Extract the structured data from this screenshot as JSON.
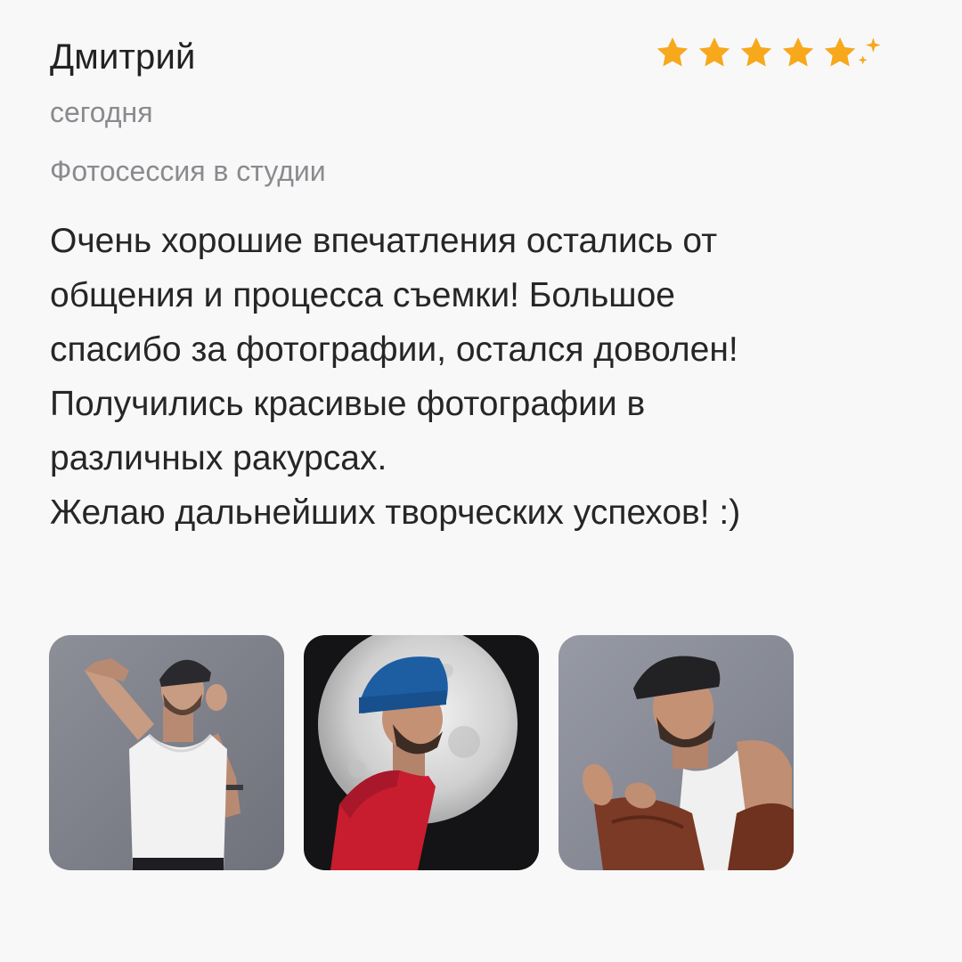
{
  "review": {
    "author": "Дмитрий",
    "date": "сегодня",
    "service": "Фотосессия в студии",
    "rating": 5,
    "rating_max": 5,
    "star_color": "#f7a81b",
    "text_lines": [
      "Очень хорошие впечатления остались от",
      "общения и процесса съемки! Большое",
      "спасибо за фотографии, остался доволен!",
      "Получились красивые фотографии в",
      "различных ракурсах.",
      "Желаю дальнейших творческих успехов! :)"
    ],
    "photos": [
      {
        "icon": "photo-man-white-tank-top-icon"
      },
      {
        "icon": "photo-man-blue-beanie-moon-icon"
      },
      {
        "icon": "photo-man-brown-jacket-icon"
      }
    ]
  }
}
